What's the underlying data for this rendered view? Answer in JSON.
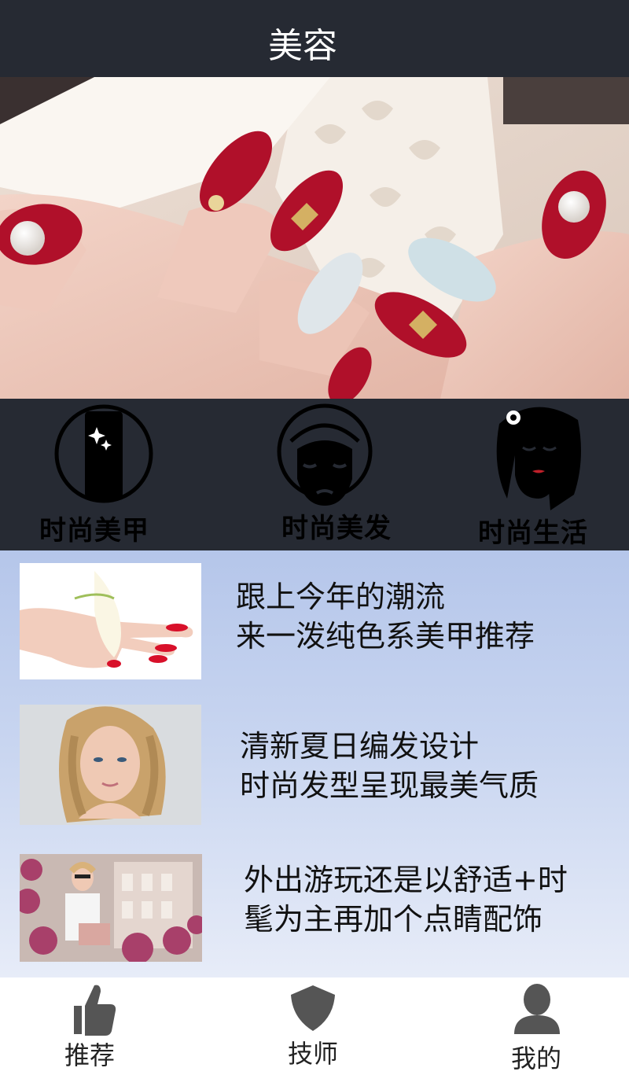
{
  "header": {
    "title": "美容"
  },
  "categories": [
    {
      "label": "时尚美甲",
      "icon": "nail-icon"
    },
    {
      "label": "时尚美发",
      "icon": "face-mask-icon"
    },
    {
      "label": "时尚生活",
      "icon": "woman-face-icon"
    }
  ],
  "articles": [
    {
      "line1": "跟上今年的潮流",
      "line2": "来一泼纯色系美甲推荐"
    },
    {
      "line1": "清新夏日编发设计",
      "line2": "时尚发型呈现最美气质"
    },
    {
      "line1": "外出游玩还是以舒适+时",
      "line2": "髦为主再加个点睛配饰"
    }
  ],
  "tabs": [
    {
      "label": "推荐",
      "icon": "thumbs-up-icon"
    },
    {
      "label": "技师",
      "icon": "shield-icon"
    },
    {
      "label": "我的",
      "icon": "user-icon"
    }
  ],
  "colors": {
    "header_bg": "#262a33",
    "feed_top": "#b5c6ea",
    "feed_bottom": "#e7ecf8",
    "nail_red": "#b0102a"
  }
}
